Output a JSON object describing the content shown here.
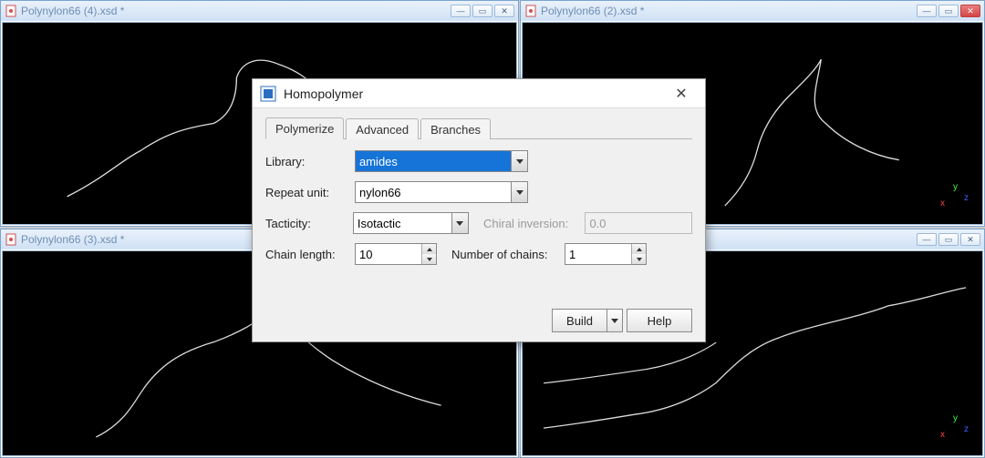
{
  "windows": {
    "tl": {
      "title": "Polynylon66 (4).xsd *"
    },
    "tr": {
      "title": "Polynylon66 (2).xsd *"
    },
    "bl": {
      "title": "Polynylon66 (3).xsd *"
    },
    "br": {
      "title": ""
    }
  },
  "window_controls": {
    "minimize": "—",
    "maximize": "▭",
    "close": "✕"
  },
  "axis": {
    "x": "x",
    "y": "y",
    "z": "z"
  },
  "dialog": {
    "title": "Homopolymer",
    "close": "✕",
    "tabs": {
      "polymerize": "Polymerize",
      "advanced": "Advanced",
      "branches": "Branches"
    },
    "labels": {
      "library": "Library:",
      "repeat_unit": "Repeat unit:",
      "tacticity": "Tacticity:",
      "chiral_inversion": "Chiral inversion:",
      "chain_length": "Chain length:",
      "number_of_chains": "Number of chains:"
    },
    "values": {
      "library": "amides",
      "repeat_unit": "nylon66",
      "tacticity": "Isotactic",
      "chiral_inversion": "0.0",
      "chain_length": "10",
      "number_of_chains": "1"
    },
    "buttons": {
      "build": "Build",
      "help": "Help"
    }
  }
}
